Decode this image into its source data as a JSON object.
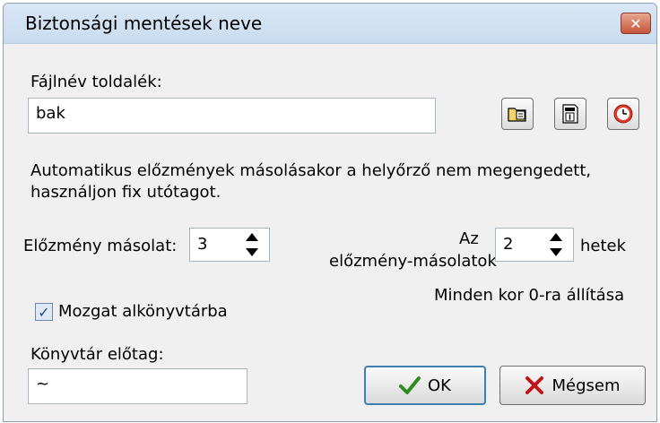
{
  "window": {
    "title": "Biztonsági mentések neve",
    "close_icon": "close-icon"
  },
  "filename_suffix": {
    "label": "Fájlnév toldalék:",
    "value": "bak"
  },
  "icon_buttons": [
    {
      "name": "folder-icon"
    },
    {
      "name": "calendar-icon"
    },
    {
      "name": "clock-icon"
    }
  ],
  "info_text": {
    "line1": "Automatikus előzmények másolásakor a helyőrző nem megengedett,",
    "line2": "használjon fix utótagot."
  },
  "history_copy": {
    "label": "Előzmény másolat:",
    "value": "3"
  },
  "history_copies_weeks": {
    "label_line1": "Az",
    "label_line2": "előzmény-másolatok",
    "value": "2",
    "unit": "hetek"
  },
  "reset_age": {
    "label": "Minden kor 0-ra állítása"
  },
  "move_to_subdir": {
    "label": "Mozgat alkönyvtárba",
    "checked": true
  },
  "dir_prefix": {
    "label": "Könyvtár előtag:",
    "value": "~"
  },
  "buttons": {
    "ok": "OK",
    "cancel": "Mégsem"
  },
  "colors": {
    "ok_check": "#2e8b1f",
    "cancel_x": "#c1131a"
  }
}
